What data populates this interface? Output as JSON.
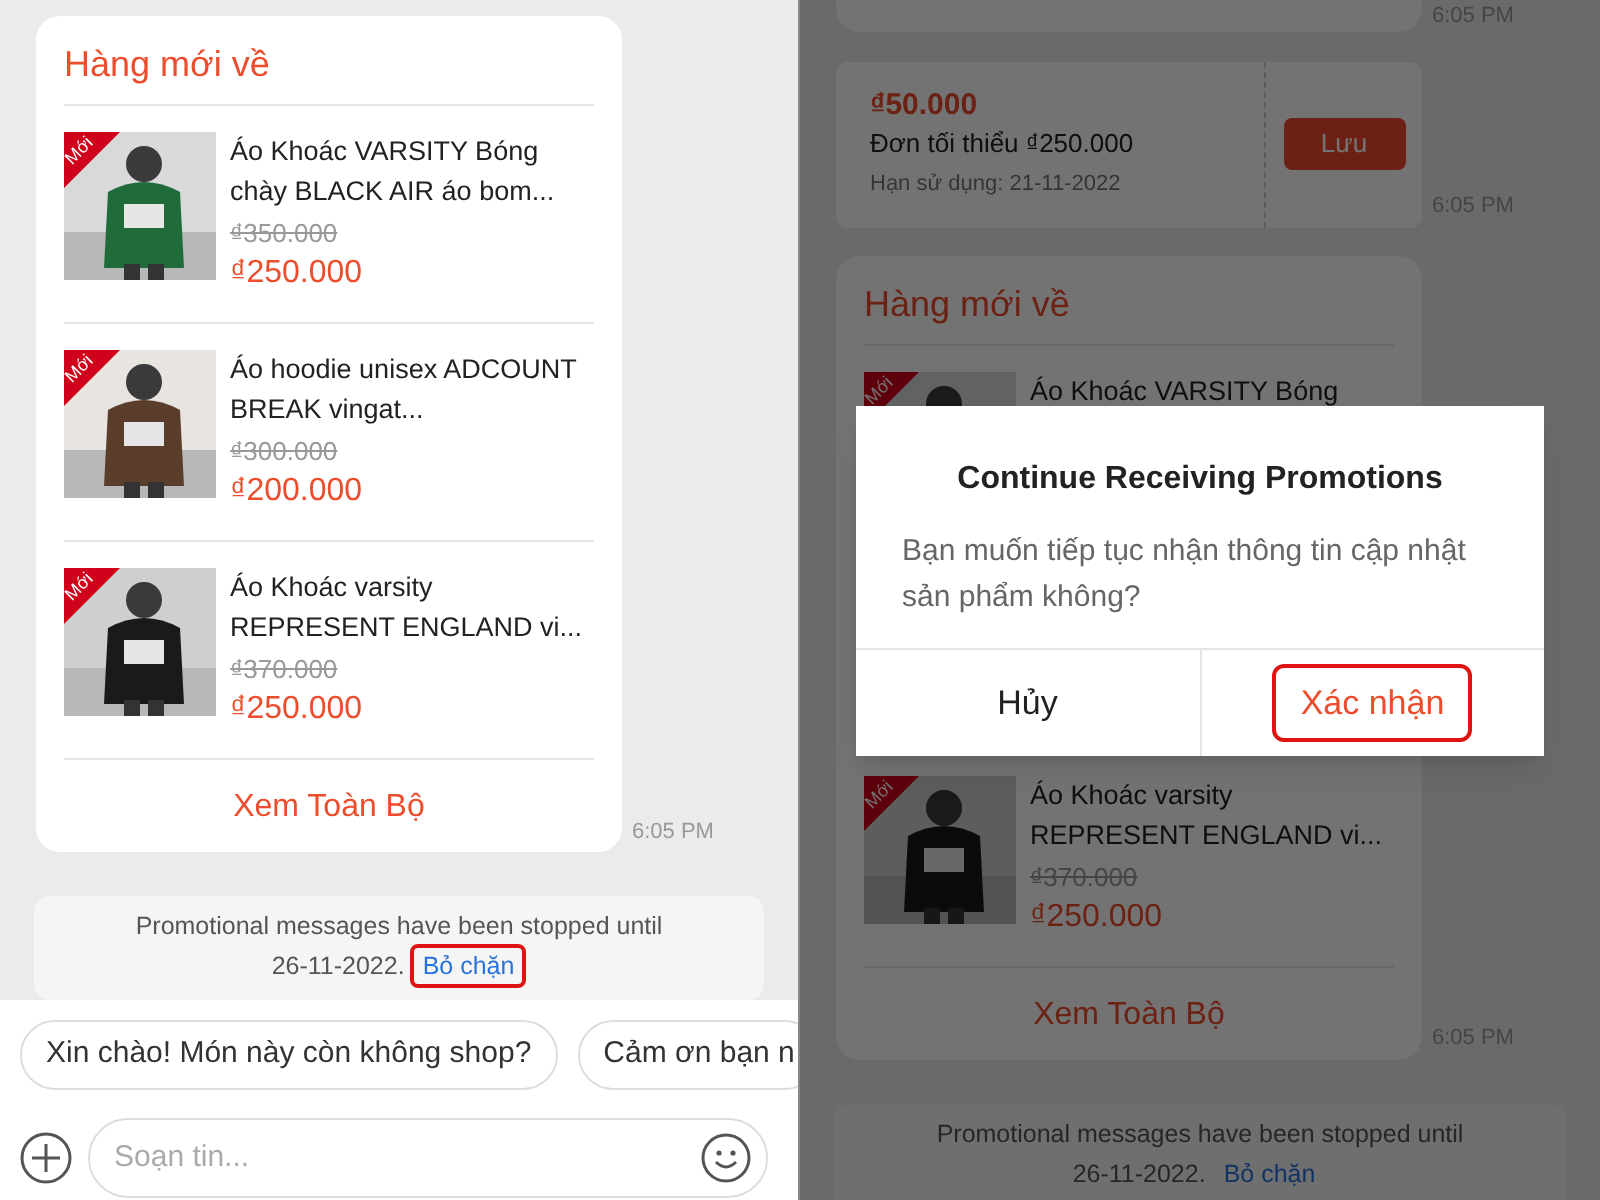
{
  "left": {
    "card": {
      "title": "Hàng mới về",
      "items": [
        {
          "badge": "Mới",
          "name": "Áo Khoác VARSITY Bóng chày BLACK AIR áo bom...",
          "old_price": "₫350.000",
          "price": "₫250.000"
        },
        {
          "badge": "Mới",
          "name": "Áo hoodie unisex ADCOUNT BREAK vingat...",
          "old_price": "₫300.000",
          "price": "₫200.000"
        },
        {
          "badge": "Mới",
          "name": "Áo Khoác varsity REPRESENT ENGLAND vi...",
          "old_price": "₫370.000",
          "price": "₫250.000"
        }
      ],
      "view_all": "Xem Toàn Bộ",
      "time": "6:05 PM"
    },
    "notice": {
      "line_1": "Promotional messages have been stopped until",
      "line_2": "26-11-2022.",
      "link": "Bỏ chặn",
      "highlighted": true
    },
    "quick_replies": [
      "Xin chào! Món này còn không shop?",
      "Cảm ơn bạn n"
    ],
    "composer": {
      "placeholder": "Soạn tin..."
    }
  },
  "right": {
    "times": [
      "6:05 PM",
      "6:05 PM"
    ],
    "voucher": {
      "amount": "₫50.000",
      "min_order": "Đơn tối thiểu ₫250.000",
      "expiry": "Hạn sử dụng: 21-11-2022",
      "button": "Lưu"
    },
    "card": {
      "title": "Hàng mới về",
      "first_item": {
        "badge": "Mới",
        "name": "Áo Khoác VARSITY Bóng"
      },
      "last_item": {
        "badge": "Mới",
        "name": "Áo Khoác varsity REPRESENT ENGLAND vi...",
        "old_price": "₫370.000",
        "price": "₫250.000"
      },
      "view_all": "Xem Toàn Bộ",
      "time": "6:05 PM"
    },
    "notice": {
      "line_1": "Promotional messages have been stopped until",
      "line_2": "26-11-2022.",
      "link": "Bỏ chặn"
    },
    "dialog": {
      "title": "Continue Receiving Promotions",
      "message": "Bạn muốn tiếp tục nhận thông tin cập nhật sản phẩm không?",
      "buttons": [
        {
          "label": "Hủy",
          "highlighted": false
        },
        {
          "label": "Xác nhận",
          "highlighted": true
        }
      ]
    }
  }
}
